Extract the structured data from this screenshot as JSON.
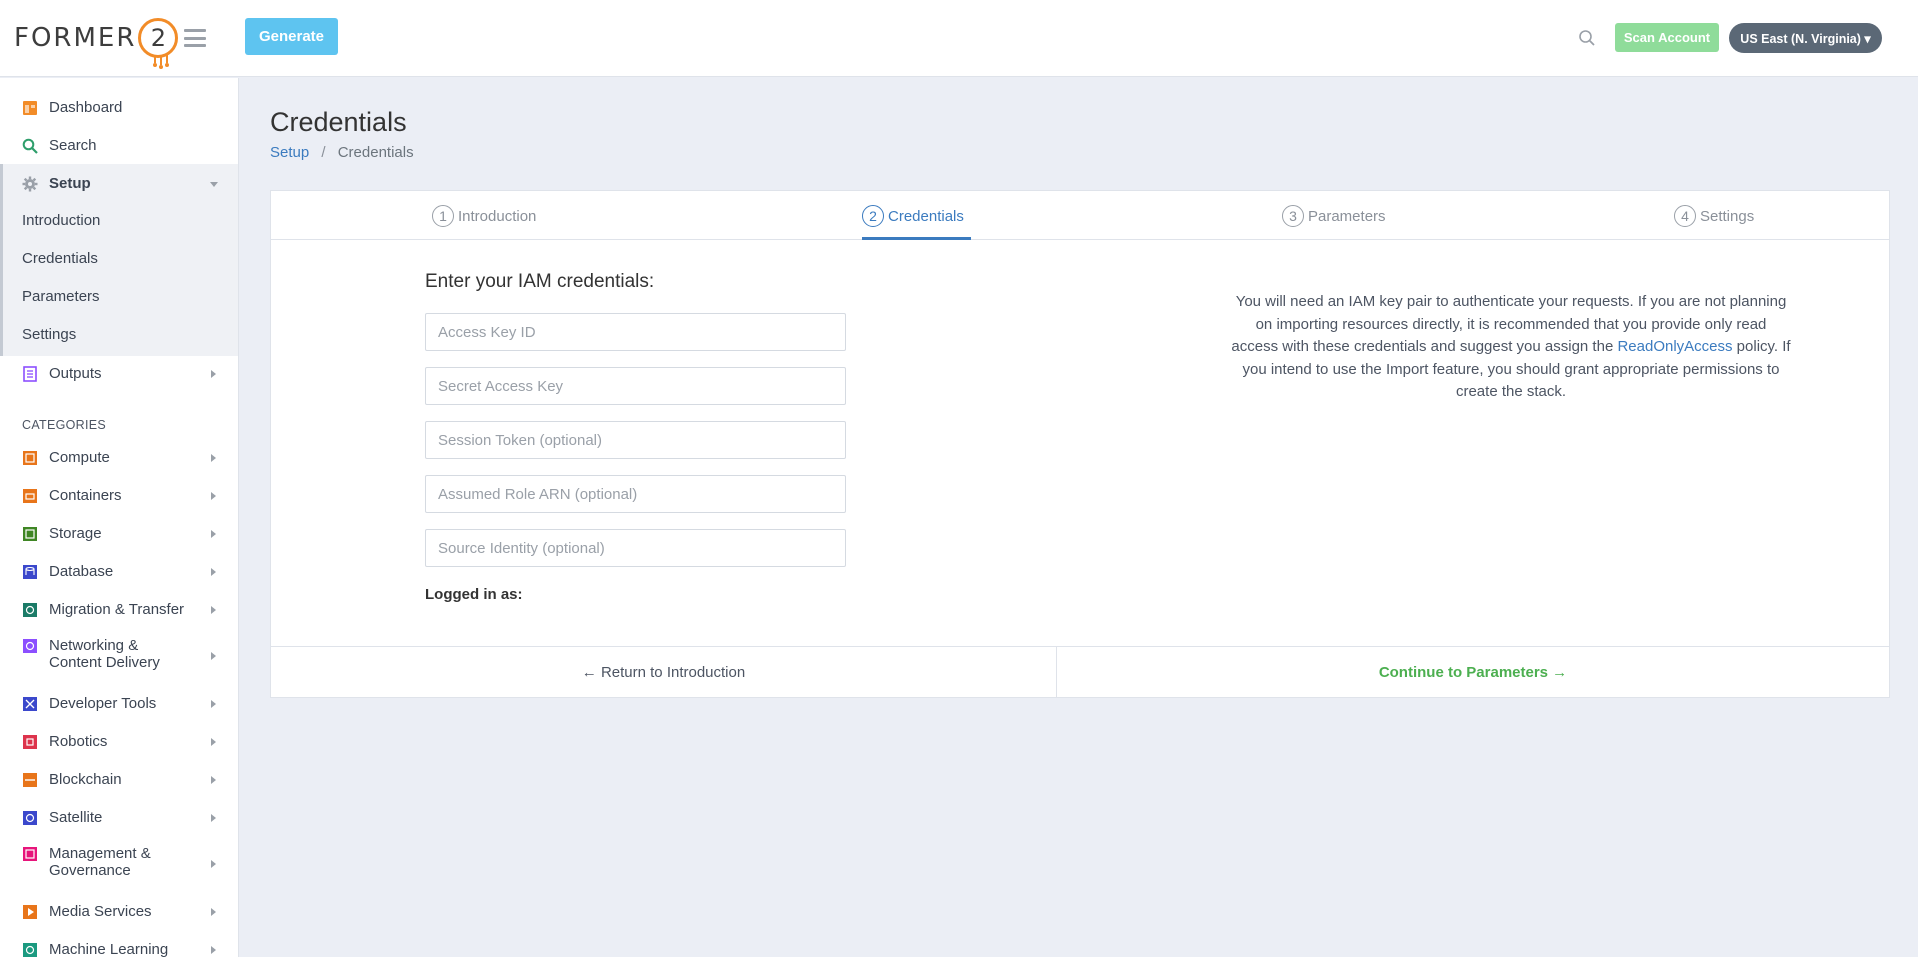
{
  "header": {
    "logo_text": "FORMER",
    "logo_num": "2",
    "generate_label": "Generate",
    "scan_label": "Scan Account",
    "region_label": "US East (N. Virginia) ▾"
  },
  "sidebar": {
    "top_items": [
      {
        "label": "Dashboard",
        "icon": "dashboard-icon",
        "color": "#f28c28"
      },
      {
        "label": "Search",
        "icon": "search-icon",
        "color": "#2e9e6b"
      },
      {
        "label": "Setup",
        "icon": "gear-icon",
        "color": "#9aa0a8"
      }
    ],
    "setup_sub": [
      "Introduction",
      "Credentials",
      "Parameters",
      "Settings"
    ],
    "outputs_label": "Outputs",
    "categories_heading": "CATEGORIES",
    "categories": [
      {
        "label": "Compute",
        "color": "#e8751a"
      },
      {
        "label": "Containers",
        "color": "#e8751a"
      },
      {
        "label": "Storage",
        "color": "#3f8624"
      },
      {
        "label": "Database",
        "color": "#3b48cc"
      },
      {
        "label": "Migration & Transfer",
        "color": "#1b7b67"
      },
      {
        "label": "Networking &",
        "label2": "Content Delivery",
        "color": "#8c4fff"
      },
      {
        "label": "Developer Tools",
        "color": "#3b48cc"
      },
      {
        "label": "Robotics",
        "color": "#dd344c"
      },
      {
        "label": "Blockchain",
        "color": "#e8751a"
      },
      {
        "label": "Satellite",
        "color": "#3b48cc"
      },
      {
        "label": "Management &",
        "label2": "Governance",
        "color": "#e7157b"
      },
      {
        "label": "Media Services",
        "color": "#e8751a"
      },
      {
        "label": "Machine Learning",
        "color": "#1b9a80"
      }
    ]
  },
  "page": {
    "title": "Credentials",
    "breadcrumb_setup": "Setup",
    "breadcrumb_sep": "/",
    "breadcrumb_current": "Credentials"
  },
  "steps": [
    {
      "num": "1",
      "label": "Introduction"
    },
    {
      "num": "2",
      "label": "Credentials"
    },
    {
      "num": "3",
      "label": "Parameters"
    },
    {
      "num": "4",
      "label": "Settings"
    }
  ],
  "form": {
    "title": "Enter your IAM credentials:",
    "access_key_placeholder": "Access Key ID",
    "secret_key_placeholder": "Secret Access Key",
    "session_token_placeholder": "Session Token (optional)",
    "role_arn_placeholder": "Assumed Role ARN (optional)",
    "source_identity_placeholder": "Source Identity (optional)",
    "logged_in_label": "Logged in as:"
  },
  "info": {
    "text_before": "You will need an IAM key pair to authenticate your requests. If you are not planning on importing resources directly, it is recommended that you provide only read access with these credentials and suggest you assign the ",
    "link": "ReadOnlyAccess",
    "text_after": " policy. If you intend to use the Import feature, you should grant appropriate permissions to create the stack."
  },
  "footer": {
    "back_label": "← Return to Introduction",
    "next_label": "Continue to Parameters →"
  }
}
